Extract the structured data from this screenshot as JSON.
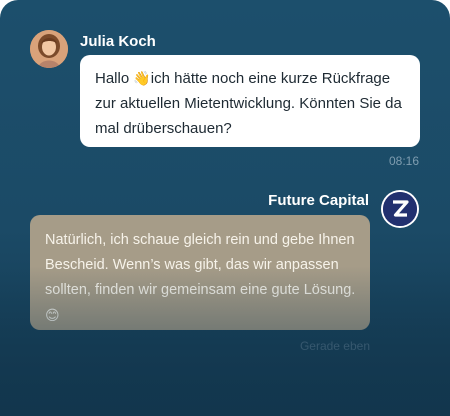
{
  "chat": {
    "incoming": {
      "sender": "Julia Koch",
      "text_before_emoji": "Hallo ",
      "emoji": "👋",
      "text_after_emoji": "ich hätte noch eine kurze Rückfrage zur aktuellen Mietentwicklung. Könnten Sie da mal drüberschauen?",
      "time": "08:16"
    },
    "outgoing": {
      "sender": "Future Capital",
      "text": "Natürlich, ich schaue gleich rein und gebe Ihnen Bescheid. Wenn’s was gibt, das wir anpassen sollten, finden wir gemeinsam eine gute Lösung.",
      "emoji": "😊",
      "time": "Gerade eben"
    }
  },
  "icons": {
    "user_avatar": "avatar-photo",
    "agent_avatar": "future-capital-logo"
  },
  "colors": {
    "background": "#1c4f6c",
    "incoming_bubble": "#ffffff",
    "outgoing_bubble": "#a69c88",
    "agent_logo_bg": "#22306f"
  }
}
